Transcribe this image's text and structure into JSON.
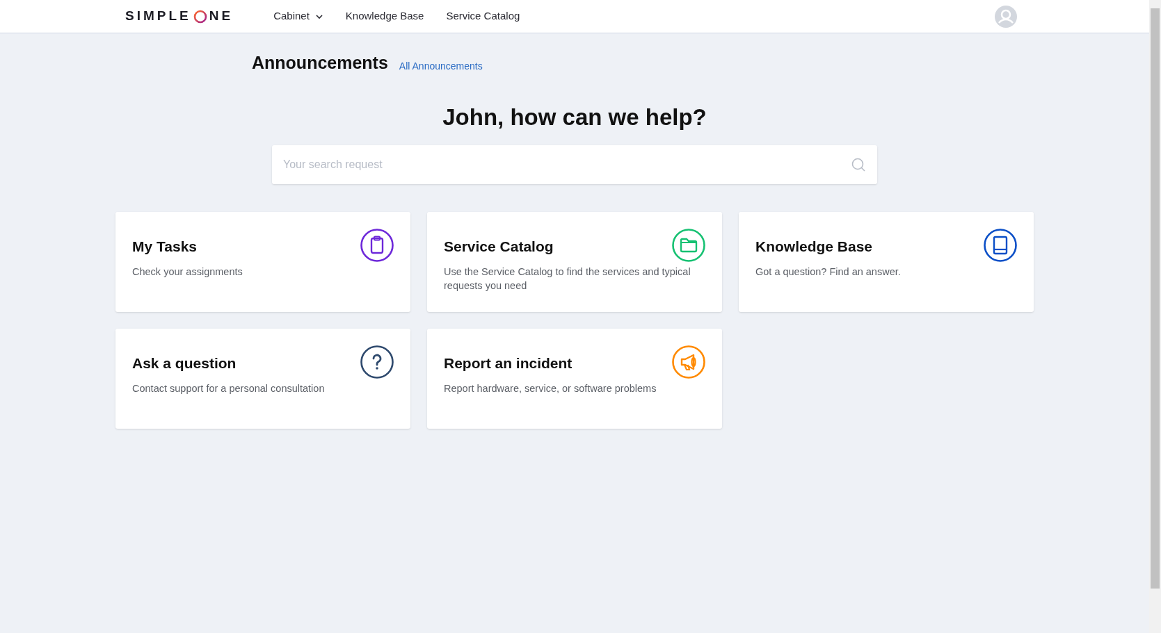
{
  "header": {
    "logo": {
      "before": "SIMPLE",
      "after": "NE"
    },
    "nav": [
      {
        "label": "Cabinet",
        "dropdown": true
      },
      {
        "label": "Knowledge Base",
        "dropdown": false
      },
      {
        "label": "Service Catalog",
        "dropdown": false
      }
    ]
  },
  "announcements": {
    "title": "Announcements",
    "link": "All Announcements"
  },
  "greeting": "John, how can we help?",
  "search": {
    "placeholder": "Your search request"
  },
  "cards": [
    {
      "title": "My Tasks",
      "description": "Check your assignments",
      "color": "#6d28d9"
    },
    {
      "title": "Service Catalog",
      "description": "Use the Service Catalog to find the services and typical requests you need",
      "color": "#16c172"
    },
    {
      "title": "Knowledge Base",
      "description": "Got a question? Find an answer.",
      "color": "#0b4fc7"
    },
    {
      "title": "Ask a question",
      "description": "Contact support for a personal consultation",
      "color": "#2f4a6e"
    },
    {
      "title": "Report an incident",
      "description": "Report hardware, service, or software problems",
      "color": "#ff8a00"
    }
  ]
}
